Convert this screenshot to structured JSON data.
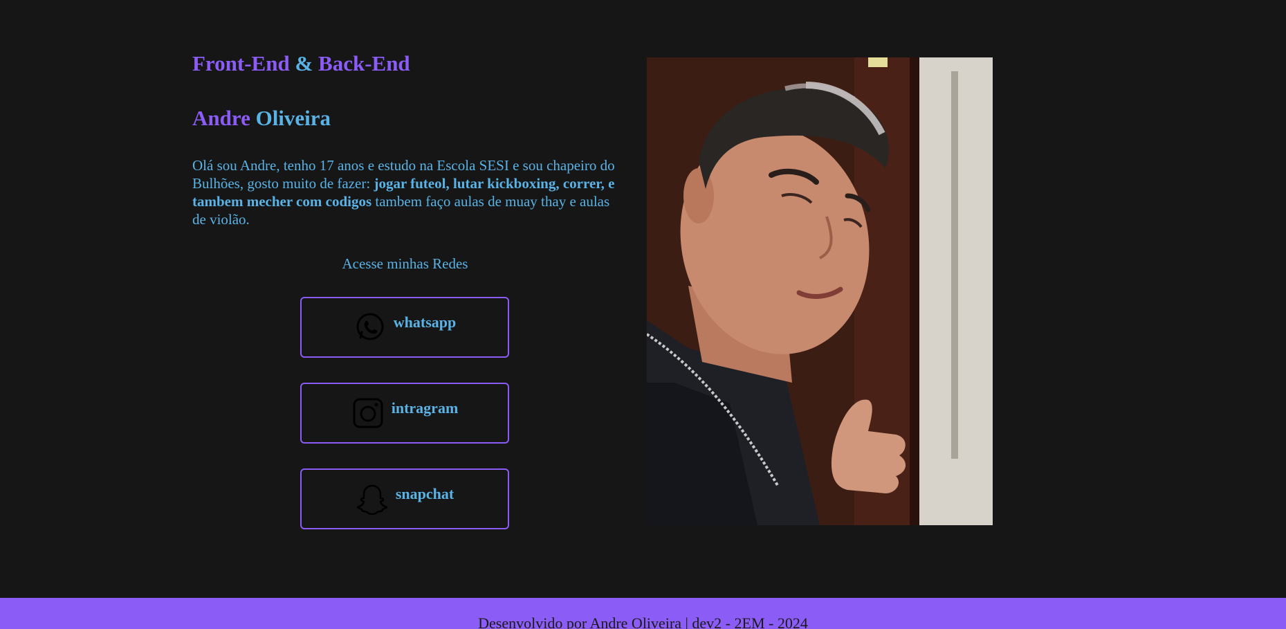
{
  "header": {
    "role_front": "Front-End",
    "role_amp": "&",
    "role_back": "Back-End"
  },
  "profile": {
    "first_name": "Andre",
    "last_name": "Oliveira",
    "bio_intro": "Olá sou Andre, tenho 17 anos e estudo na Escola SESI e sou chapeiro do Bulhões, gosto muito de fazer: ",
    "bio_bold": "jogar futeol, lutar kickboxing, correr, e tambem mecher com codigos",
    "bio_outro": " tambem faço aulas de muay thay e aulas de violão."
  },
  "social": {
    "title": "Acesse minhas Redes",
    "links": [
      {
        "label": "whatsapp",
        "icon": "whatsapp-icon"
      },
      {
        "label": "intragram",
        "icon": "instagram-icon"
      },
      {
        "label": "snapchat",
        "icon": "snapchat-icon"
      }
    ]
  },
  "photo": {
    "subject": "profile-photo"
  },
  "footer": {
    "text": "Desenvolvido por Andre Oliveira | dev2 - 2EM - 2024"
  },
  "colors": {
    "background": "#161616",
    "accent_purple": "#8b5cf6",
    "accent_blue": "#5ab3e6"
  }
}
